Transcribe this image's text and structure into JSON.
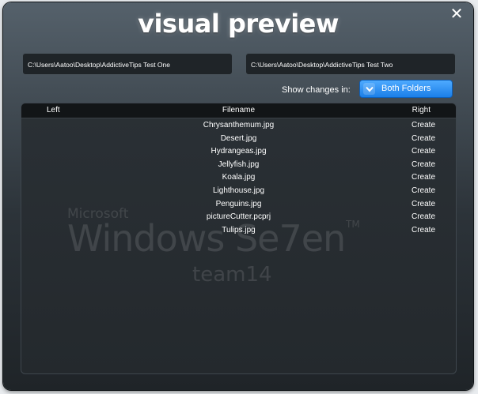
{
  "window": {
    "title": "visual preview"
  },
  "paths": {
    "left": "C:\\Users\\Aatoo\\Desktop\\AddictiveTips Test One",
    "right": "C:\\Users\\Aatoo\\Desktop\\AddictiveTips Test Two"
  },
  "filter": {
    "label": "Show changes in:",
    "selected": "Both Folders"
  },
  "table": {
    "headers": {
      "left": "Left",
      "filename": "Filename",
      "right": "Right"
    },
    "rows": [
      {
        "filename": "Chrysanthemum.jpg",
        "right": "Create"
      },
      {
        "filename": "Desert.jpg",
        "right": "Create"
      },
      {
        "filename": "Hydrangeas.jpg",
        "right": "Create"
      },
      {
        "filename": "Jellyfish.jpg",
        "right": "Create"
      },
      {
        "filename": "Koala.jpg",
        "right": "Create"
      },
      {
        "filename": "Lighthouse.jpg",
        "right": "Create"
      },
      {
        "filename": "Penguins.jpg",
        "right": "Create"
      },
      {
        "filename": "pictureCutter.pcprj",
        "right": "Create"
      },
      {
        "filename": "Tulips.jpg",
        "right": "Create"
      }
    ]
  },
  "watermark": {
    "line1": "Microsoft",
    "line2": "Windows Se7en",
    "tm": "TM",
    "line3": "team14"
  },
  "colors": {
    "accent": "#1b7fe8",
    "background": "#2c3339"
  },
  "icons": {
    "close": "close-icon",
    "dropdown": "chevron-down-icon"
  }
}
